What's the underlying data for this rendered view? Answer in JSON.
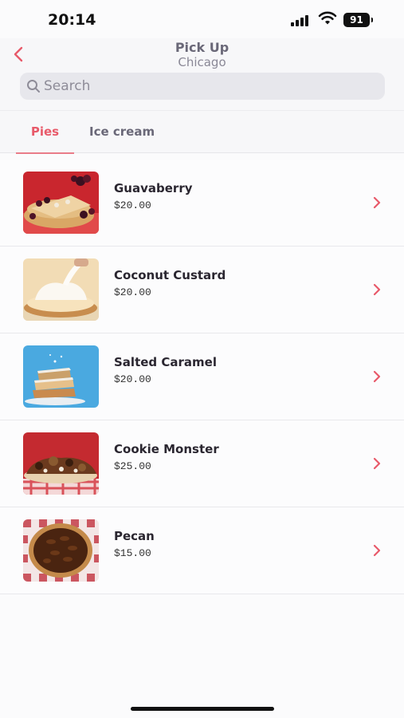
{
  "status": {
    "time": "20:14",
    "battery": "91"
  },
  "header": {
    "title": "Pick Up",
    "subtitle": "Chicago"
  },
  "search": {
    "placeholder": "Search",
    "value": ""
  },
  "tabs": [
    {
      "label": "Pies"
    },
    {
      "label": "Ice cream"
    }
  ],
  "items": [
    {
      "name": "Guavaberry",
      "price": "$20.00"
    },
    {
      "name": "Coconut Custard",
      "price": "$20.00"
    },
    {
      "name": "Salted Caramel",
      "price": "$20.00"
    },
    {
      "name": "Cookie Monster",
      "price": "$25.00"
    },
    {
      "name": "Pecan",
      "price": "$15.00"
    }
  ],
  "colors": {
    "accent": "#e85a6a",
    "muted": "#6a6878"
  }
}
